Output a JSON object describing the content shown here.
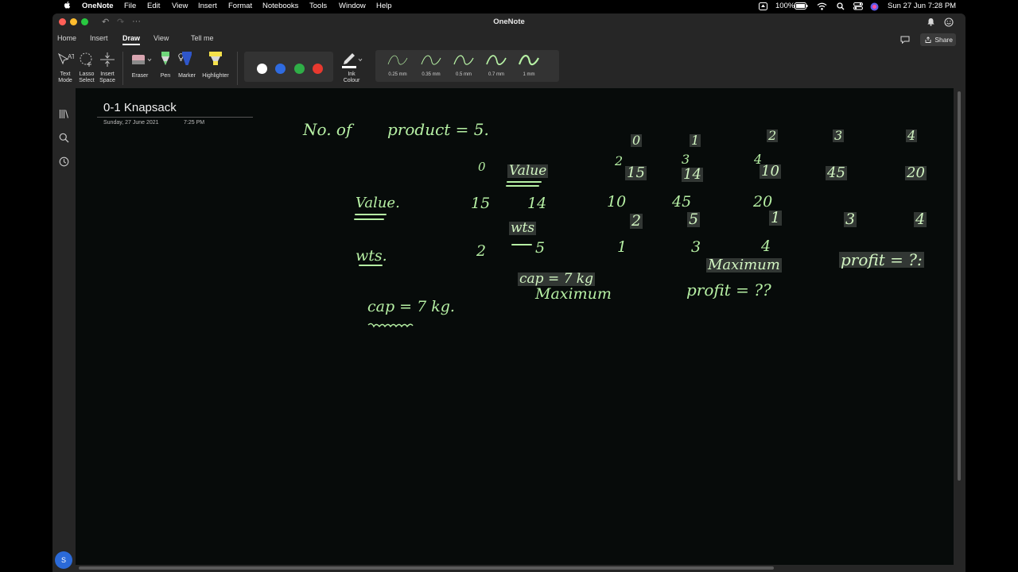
{
  "menubar": {
    "app_name": "OneNote",
    "items": [
      "File",
      "Edit",
      "View",
      "Insert",
      "Format",
      "Notebooks",
      "Tools",
      "Window",
      "Help"
    ],
    "battery": "100%",
    "datetime": "Sun 27 Jun  7:28 PM"
  },
  "window": {
    "title": "OneNote",
    "tabs": [
      "Home",
      "Insert",
      "Draw",
      "View"
    ],
    "active_tab": "Draw",
    "tell_me": "Tell me",
    "share": "Share"
  },
  "ribbon": {
    "text_mode": [
      "Text",
      "Mode"
    ],
    "lasso_select": [
      "Lasso",
      "Select"
    ],
    "insert_space": [
      "Insert",
      "Space"
    ],
    "eraser": "Eraser",
    "pen": "Pen",
    "marker": "Marker",
    "highlighter": "Highlighter",
    "pen_colors": [
      "#ffffff",
      "#2f6be0",
      "#2fae47",
      "#e8392f"
    ],
    "ink_colour": [
      "Ink",
      "Colour"
    ],
    "thicknesses": [
      "0.25 mm",
      "0.35 mm",
      "0.5 mm",
      "0.7 mm",
      "1 mm"
    ],
    "ink_color": "#b6f0a4"
  },
  "sidebar": {
    "avatar_initial": "S"
  },
  "page": {
    "title": "0-1 Knapsack",
    "date": "Sunday, 27 June 2021",
    "time": "7:25 PM"
  },
  "ink": {
    "no_of_product": "No. of",
    "product_eq": "product = 5.",
    "zero": "0",
    "value_label": "Value.",
    "values": [
      "15",
      "14",
      "10",
      "45",
      "20"
    ],
    "wts_label": "wts.",
    "weights": [
      "2",
      "5",
      "1",
      "3",
      "4"
    ],
    "cap": "cap = 7 kg.",
    "maximum": "Maximum",
    "profit": "profit = ??",
    "copy_indices": [
      "0",
      "1",
      "2",
      "3",
      "4"
    ],
    "copy_value": "Value",
    "copy_wts": "wts",
    "copy_values": [
      "15",
      "14",
      "10",
      "45",
      "20"
    ],
    "copy_weights": [
      "2",
      "5",
      "1",
      "3",
      "4"
    ],
    "copy_cap": "cap = 7 kg",
    "copy_maximum": "Maximum",
    "copy_profit": "profit = ?:",
    "stray_digits": [
      "2",
      "3",
      "4"
    ]
  }
}
